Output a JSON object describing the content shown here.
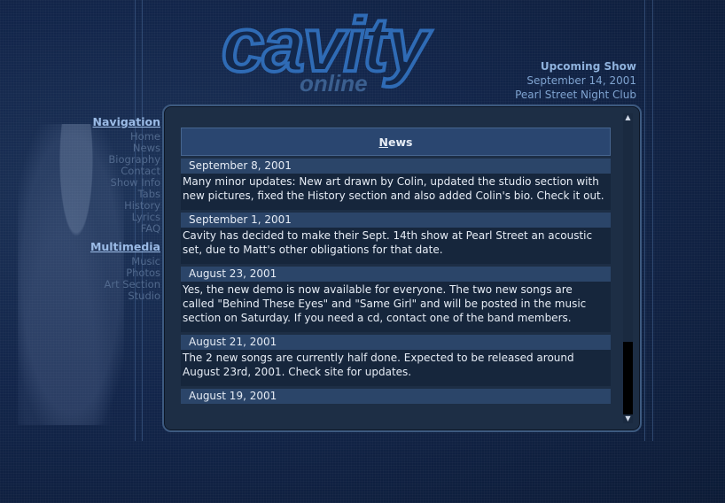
{
  "logo": {
    "main": "cavity",
    "sub": "online"
  },
  "upcoming": {
    "title": "Upcoming Show",
    "date": "September 14, 2001",
    "venue": "Pearl Street Night Club"
  },
  "navigation": {
    "heading": "Navigation",
    "items": [
      "Home",
      "News",
      "Biography",
      "Contact",
      "Show Info",
      "Tabs",
      "History",
      "Lyrics",
      "FAQ"
    ]
  },
  "multimedia": {
    "heading": "Multimedia",
    "items": [
      "Music",
      "Photos",
      "Art Section",
      "Studio"
    ]
  },
  "news": {
    "heading_initial": "N",
    "heading_rest": "ews",
    "entries": [
      {
        "date": "September 8, 2001",
        "body": "Many minor updates: New art drawn by Colin, updated the studio section with new pictures, fixed the History section and also added Colin's bio. Check it out."
      },
      {
        "date": "September 1, 2001",
        "body": "Cavity has decided to make their Sept. 14th show at Pearl Street an acoustic set, due to Matt's other obligations for that date."
      },
      {
        "date": "August 23, 2001",
        "body": "Yes, the new demo is now available for everyone. The two new songs are called \"Behind These Eyes\" and \"Same Girl\" and will be posted in the music section on Saturday. If you need a cd, contact one of the band members."
      },
      {
        "date": "August 21, 2001",
        "body": "The 2 new songs are currently half done. Expected to be released around August 23rd, 2001. Check site for updates."
      },
      {
        "date": "August 19, 2001",
        "body": ""
      }
    ]
  },
  "scrollbar": {
    "up_icon": "triangle-up",
    "down_icon": "triangle-down"
  },
  "colors": {
    "accent": "#7fa3d0",
    "panel": "#1d2e45",
    "date_bar": "#2b4569"
  }
}
